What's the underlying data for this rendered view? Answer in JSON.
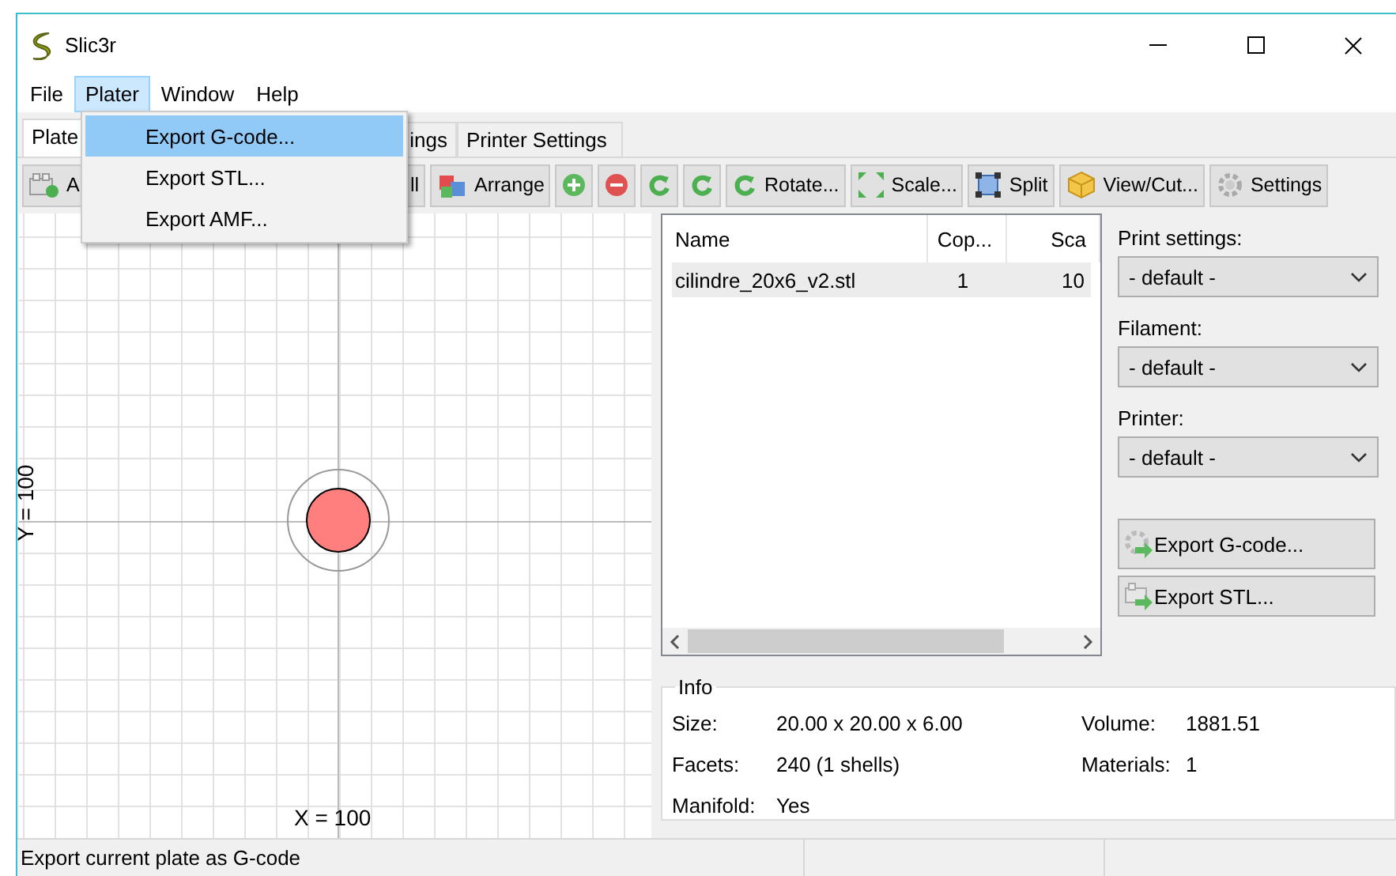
{
  "window": {
    "title": "Slic3r"
  },
  "menu_bar": [
    {
      "label": "File",
      "selected": false
    },
    {
      "label": "Plater",
      "selected": true
    },
    {
      "label": "Window",
      "selected": false
    },
    {
      "label": "Help",
      "selected": false
    }
  ],
  "open_menu": {
    "items": [
      {
        "label": "Export G-code...",
        "selected": true
      },
      {
        "label": "Export STL...",
        "selected": false
      },
      {
        "label": "Export AMF...",
        "selected": false
      }
    ]
  },
  "tabs": [
    {
      "label": "Plate",
      "selected": true
    },
    {
      "label": "ings",
      "selected": false
    },
    {
      "label": "Printer Settings",
      "selected": false
    }
  ],
  "toolbar": [
    {
      "kind": "add",
      "label": "A"
    },
    {
      "kind": "delete_all",
      "label": "ll"
    },
    {
      "kind": "arrange",
      "label": "Arrange"
    },
    {
      "kind": "plus"
    },
    {
      "kind": "minus"
    },
    {
      "kind": "rotate_left"
    },
    {
      "kind": "rotate_right"
    },
    {
      "kind": "rotate",
      "label": "Rotate..."
    },
    {
      "kind": "scale",
      "label": "Scale..."
    },
    {
      "kind": "split",
      "label": "Split"
    },
    {
      "kind": "cut",
      "label": "View/Cut..."
    },
    {
      "kind": "settings",
      "label": "Settings"
    }
  ],
  "plate": {
    "x_label": "X = 100",
    "y_label": "Y = 100"
  },
  "object_list": {
    "columns": [
      "Name",
      "Cop...",
      "Sca"
    ],
    "rows": [
      {
        "cells": [
          "cilindre_20x6_v2.stl",
          "1",
          "10"
        ],
        "selected": true
      }
    ]
  },
  "presets": [
    {
      "label": "Print settings:",
      "value": "- default -"
    },
    {
      "label": "Filament:",
      "value": "- default -"
    },
    {
      "label": "Printer:",
      "value": "- default -"
    }
  ],
  "export_buttons": [
    {
      "kind": "gcode",
      "label": "Export G-code..."
    },
    {
      "kind": "stl",
      "label": "Export STL..."
    }
  ],
  "info": {
    "title": "Info",
    "left": [
      {
        "label": "Size:",
        "value": "20.00 x 20.00 x 6.00"
      },
      {
        "label": "Facets:",
        "value": "240 (1 shells)"
      },
      {
        "label": "Manifold:",
        "value": "Yes"
      }
    ],
    "right": [
      {
        "label": "Volume:",
        "value": "1881.51"
      },
      {
        "label": "Materials:",
        "value": "1"
      }
    ]
  },
  "status_bar": "Export current plate as G-code"
}
